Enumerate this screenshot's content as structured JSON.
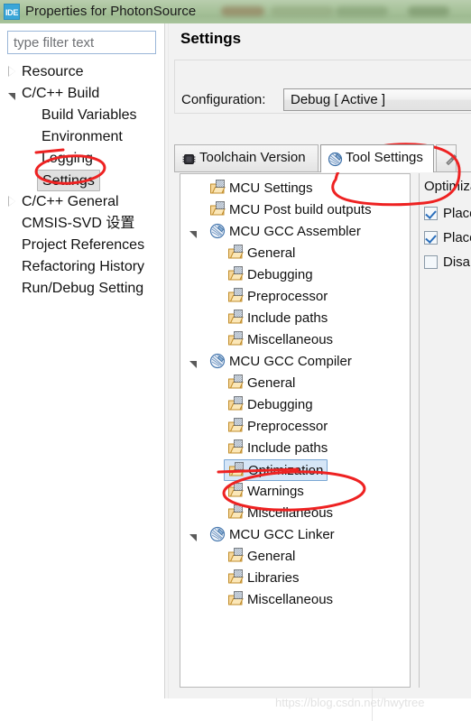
{
  "window": {
    "title": "Properties for PhotonSource",
    "icon": "ide-icon",
    "icon_text": "IDE"
  },
  "filter": {
    "placeholder": "type filter text",
    "value": ""
  },
  "nav_tree": {
    "items": [
      {
        "label": "Resource",
        "indent": 24,
        "twisty": "collapsed",
        "selected": false
      },
      {
        "label": "C/C++ Build",
        "indent": 24,
        "twisty": "expanded",
        "selected": false
      },
      {
        "label": "Build Variables",
        "indent": 46,
        "twisty": "none",
        "selected": false
      },
      {
        "label": "Environment",
        "indent": 46,
        "twisty": "none",
        "selected": false
      },
      {
        "label": "Logging",
        "indent": 46,
        "twisty": "none",
        "selected": false
      },
      {
        "label": "Settings",
        "indent": 46,
        "twisty": "none",
        "selected": true
      },
      {
        "label": "C/C++ General",
        "indent": 24,
        "twisty": "collapsed",
        "selected": false
      },
      {
        "label": "CMSIS-SVD 设置",
        "indent": 24,
        "twisty": "none",
        "selected": false
      },
      {
        "label": "Project References",
        "indent": 24,
        "twisty": "none",
        "selected": false
      },
      {
        "label": "Refactoring History",
        "indent": 24,
        "twisty": "none",
        "selected": false
      },
      {
        "label": "Run/Debug Setting",
        "indent": 24,
        "twisty": "none",
        "selected": false
      }
    ]
  },
  "page": {
    "title": "Settings",
    "configuration_label": "Configuration:",
    "configuration_value": "Debug  [ Active ]"
  },
  "tabs": [
    {
      "label": "Toolchain  Version",
      "icon": "chip-icon",
      "active": false
    },
    {
      "label": "Tool Settings",
      "icon": "tool-settings-icon",
      "active": true
    },
    {
      "label": "",
      "icon": "build-steps-icon",
      "active": false
    }
  ],
  "tool_tree": {
    "items": [
      {
        "label": "MCU Settings",
        "indent": 32,
        "icon": "folder-settings-icon",
        "twisty": "none",
        "selected": false
      },
      {
        "label": "MCU Post build outputs",
        "indent": 32,
        "icon": "folder-settings-icon",
        "twisty": "none",
        "selected": false
      },
      {
        "label": "MCU GCC Assembler",
        "indent": 32,
        "icon": "tool-icon",
        "twisty": "expanded",
        "selected": false
      },
      {
        "label": "General",
        "indent": 52,
        "icon": "folder-settings-icon",
        "twisty": "none",
        "selected": false
      },
      {
        "label": "Debugging",
        "indent": 52,
        "icon": "folder-settings-icon",
        "twisty": "none",
        "selected": false
      },
      {
        "label": "Preprocessor",
        "indent": 52,
        "icon": "folder-settings-icon",
        "twisty": "none",
        "selected": false
      },
      {
        "label": "Include paths",
        "indent": 52,
        "icon": "folder-settings-icon",
        "twisty": "none",
        "selected": false
      },
      {
        "label": "Miscellaneous",
        "indent": 52,
        "icon": "folder-settings-icon",
        "twisty": "none",
        "selected": false
      },
      {
        "label": "MCU GCC Compiler",
        "indent": 32,
        "icon": "tool-icon",
        "twisty": "expanded",
        "selected": false
      },
      {
        "label": "General",
        "indent": 52,
        "icon": "folder-settings-icon",
        "twisty": "none",
        "selected": false
      },
      {
        "label": "Debugging",
        "indent": 52,
        "icon": "folder-settings-icon",
        "twisty": "none",
        "selected": false
      },
      {
        "label": "Preprocessor",
        "indent": 52,
        "icon": "folder-settings-icon",
        "twisty": "none",
        "selected": false
      },
      {
        "label": "Include paths",
        "indent": 52,
        "icon": "folder-settings-icon",
        "twisty": "none",
        "selected": false
      },
      {
        "label": "Optimization",
        "indent": 52,
        "icon": "folder-settings-icon",
        "twisty": "none",
        "selected": true
      },
      {
        "label": "Warnings",
        "indent": 52,
        "icon": "folder-settings-icon",
        "twisty": "none",
        "selected": false
      },
      {
        "label": "Miscellaneous",
        "indent": 52,
        "icon": "folder-settings-icon",
        "twisty": "none",
        "selected": false
      },
      {
        "label": "MCU GCC Linker",
        "indent": 32,
        "icon": "tool-icon",
        "twisty": "expanded",
        "selected": false
      },
      {
        "label": "General",
        "indent": 52,
        "icon": "folder-settings-icon",
        "twisty": "none",
        "selected": false
      },
      {
        "label": "Libraries",
        "indent": 52,
        "icon": "folder-settings-icon",
        "twisty": "none",
        "selected": false
      },
      {
        "label": "Miscellaneous",
        "indent": 52,
        "icon": "folder-settings-icon",
        "twisty": "none",
        "selected": false
      }
    ]
  },
  "options_panel": {
    "heading": "Optimiza",
    "checkboxes": [
      {
        "label": "Place",
        "checked": true
      },
      {
        "label": "Place",
        "checked": true
      },
      {
        "label": "Disab",
        "checked": false
      }
    ]
  },
  "annotations": [
    {
      "name": "settings-nav-circle",
      "shape": "ellipse"
    },
    {
      "name": "tool-settings-tab-circle",
      "shape": "ellipse"
    },
    {
      "name": "optimization-circle",
      "shape": "ellipse"
    },
    {
      "name": "optimization-underline",
      "shape": "line"
    }
  ],
  "watermark": {
    "text": "https://blog.csdn.net/hwytree"
  },
  "colors": {
    "titlebar_green": "#a9c39c",
    "ide_icon_blue": "#3aa6d8",
    "selection_blue": "#d6e6f7",
    "selection_border": "#7aa7d4",
    "nav_selection_gray": "#e0e0e0",
    "annotation_red": "#ee2222",
    "folder_icon_orange": "#e8a73a",
    "tool_icon_blue": "#5b8fc9",
    "watermark_gray": "#e2e2e2"
  }
}
